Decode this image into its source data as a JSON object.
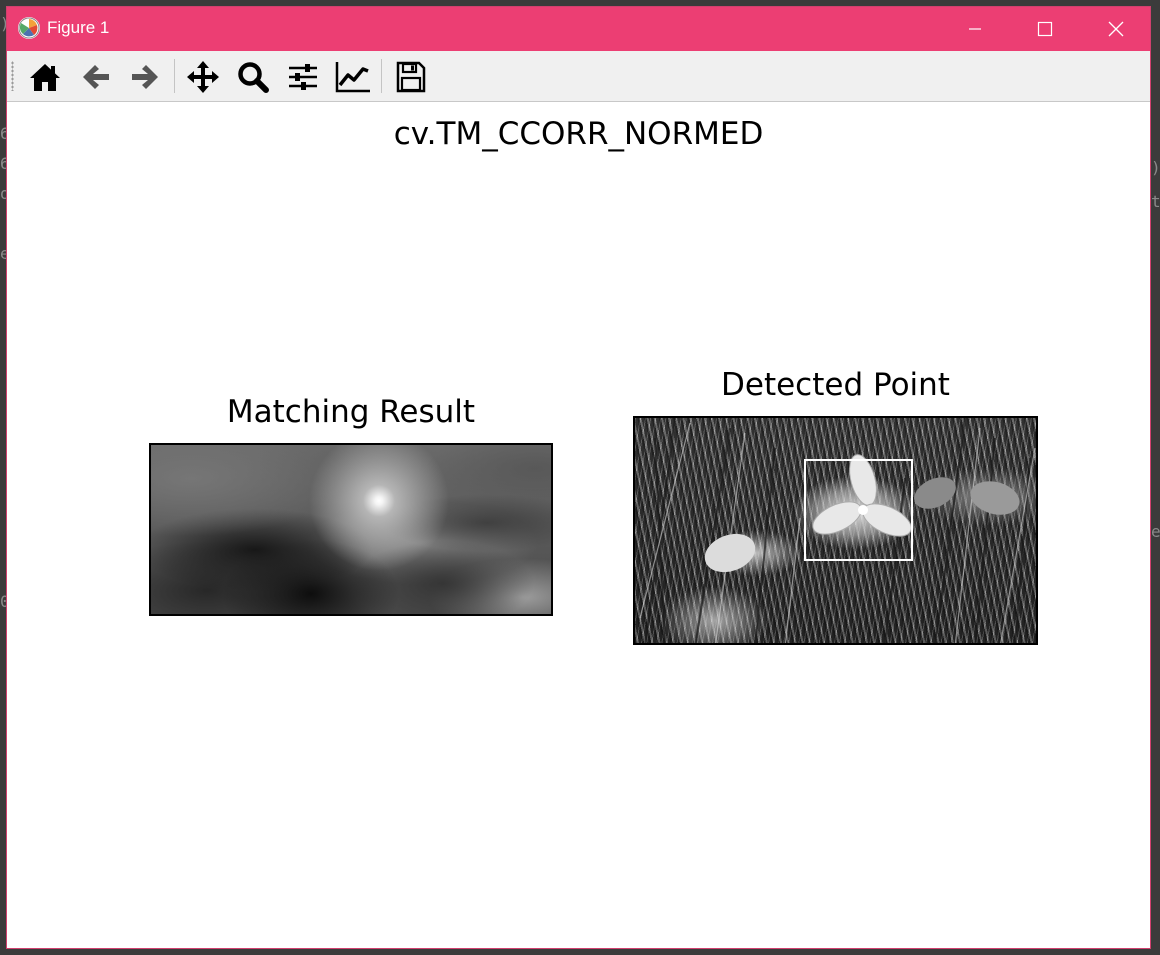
{
  "window": {
    "title": "Figure 1",
    "accent_color": "#ec3e73"
  },
  "titlebar_buttons": [
    "minimize-icon",
    "maximize-icon",
    "close-icon"
  ],
  "toolbar": {
    "tools": [
      "home-icon",
      "back-arrow-icon",
      "forward-arrow-icon",
      "pan-move-icon",
      "zoom-magnifier-icon",
      "configure-subplots-icon",
      "edit-axes-curve-icon",
      "save-floppy-icon"
    ]
  },
  "figure": {
    "suptitle": "cv.TM_CCORR_NORMED",
    "subplots": [
      {
        "title": "Matching Result"
      },
      {
        "title": "Detected Point"
      }
    ]
  }
}
